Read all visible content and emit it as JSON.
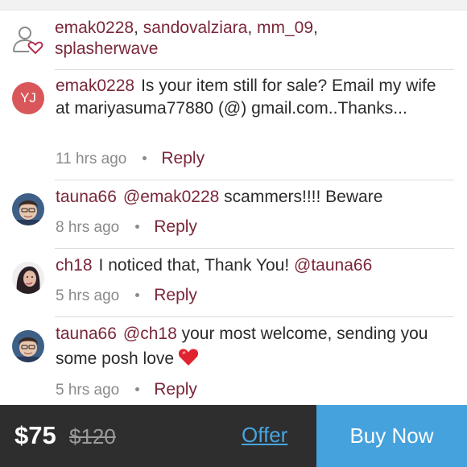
{
  "likes": {
    "icon": "user-heart-icon",
    "users": [
      "emak0228",
      "sandovalziara",
      "mm_09",
      "splasherwave"
    ]
  },
  "comments": [
    {
      "avatar_initials": "YJ",
      "username": "emak0228",
      "text": "Is your item still for sale? Email my wife at mariyasuma77880 (@) gmail.com..Thanks...",
      "time": "11 hrs ago",
      "reply_label": "Reply"
    },
    {
      "username": "tauna66",
      "mention": "@emak0228",
      "text": "scammers!!!! Beware",
      "time": "8 hrs ago",
      "reply_label": "Reply"
    },
    {
      "username": "ch18",
      "text": "I noticed that, Thank You!",
      "mention": "@tauna66",
      "time": "5 hrs ago",
      "reply_label": "Reply"
    },
    {
      "username": "tauna66",
      "mention": "@ch18",
      "text": "your most welcome, sending you some posh love",
      "emoji": "red-heart-icon",
      "time": "5 hrs ago",
      "reply_label": "Reply"
    }
  ],
  "footer": {
    "price": "$75",
    "original_price": "$120",
    "offer_label": "Offer",
    "buy_label": "Buy Now",
    "colors": {
      "bar_bg": "#2e2e2e",
      "buy_bg": "#46a2dc",
      "offer_link": "#46a6e0"
    }
  },
  "colors": {
    "username": "#7a2739",
    "meta": "#8a8a8a",
    "avatar_initials_bg": "#d9575a"
  }
}
